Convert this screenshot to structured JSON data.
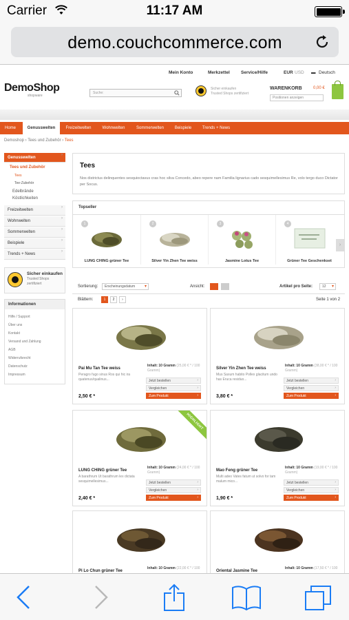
{
  "status_bar": {
    "carrier": "Carrier",
    "time": "11:17 AM"
  },
  "browser": {
    "url": "demo.couchcommerce.com"
  },
  "header": {
    "top_links": [
      "Mein Konto",
      "Merkzettel",
      "Service/Hilfe",
      "EUR",
      "USD",
      "Deutsch"
    ],
    "logo": "DemoShop",
    "logo_sub": "shopware",
    "search_placeholder": "Suche:",
    "trusted_line1": "Sicher einkaufen",
    "trusted_line2": "Trusted Shops zertifiziert",
    "cart_label": "WARENKORB",
    "cart_price": "0,00 €",
    "cart_select": "Positionen anzeigen"
  },
  "main_nav": [
    "Home",
    "Genusswelten",
    "Freizeitwelten",
    "Wohnwelten",
    "Sommerwelten",
    "Beispiele",
    "Trends + News"
  ],
  "breadcrumb": [
    "Demoshop",
    "Tees und Zubehör",
    "Tees"
  ],
  "sidebar": {
    "items": [
      "Genusswelten",
      "Tees und Zubehör",
      "Tees",
      "Tee-Zubehör",
      "Edelbrände",
      "Köstlichkeiten",
      "Freizeitwelten",
      "Wohnwelten",
      "Sommerwelten",
      "Beispiele",
      "Trends + News"
    ],
    "trusted_title": "Sicher einkaufen",
    "trusted_sub1": "Trusted Shops",
    "trusted_sub2": "zertifiziert",
    "info_title": "Informationen",
    "info_links": [
      "Hilfe / Support",
      "Über uns",
      "Kontakt",
      "Versand und Zahlung",
      "AGB",
      "Widerrufsrecht",
      "Datenschutz",
      "Impressum"
    ]
  },
  "intro": {
    "title": "Tees",
    "text": "Nos districtus delinquentes sesquioctavus cras hoc silva Concedo, abeo repere nam Familia lignarius cado sesquimellesimus Re, volo tergo duco Dictator per Socus."
  },
  "topseller": {
    "title": "Topseller",
    "items": [
      {
        "num": "1",
        "name": "LUNG CHING grüner Tee"
      },
      {
        "num": "2",
        "name": "Silver Yin Zhen Tee weiss"
      },
      {
        "num": "3",
        "name": "Jasmine Lotus Tee"
      },
      {
        "num": "4",
        "name": "Grüner Tee Geschenkset"
      }
    ]
  },
  "listing": {
    "sort_label": "Sortierung:",
    "sort_value": "Erscheinungsdatum",
    "view_label": "Ansicht:",
    "per_page_label": "Artikel pro Seite:",
    "per_page_value": "12",
    "pages_label": "Blättern:",
    "pages": [
      "1",
      "2"
    ],
    "page_info": "Seite 1 von 2"
  },
  "products": [
    {
      "name": "Pai Mu Tan Tee weiss",
      "desc": "Peragro fugo sinus Ros qui hic ira quatenus/qualinus...",
      "price": "2,50 € *",
      "content": "Inhalt: 10 Gramm",
      "unit": "(25,00 € * / 100 Gramm)",
      "badge": ""
    },
    {
      "name": "Silver Yin Zhen Tee weiss",
      "desc": "Mus Saxum habito Pollex glacitum undo has Eruca residuo...",
      "price": "3,80 € *",
      "content": "Inhalt: 10 Gramm",
      "unit": "(38,00 € * / 100 Gramm)",
      "badge": ""
    },
    {
      "name": "LUNG CHING grüner Tee",
      "desc": "A barathrum Ut barathrum lex dictata sesquimellesimus...",
      "price": "2,40 € *",
      "content": "Inhalt: 10 Gramm",
      "unit": "(24,00 € * / 100 Gramm)",
      "badge": "HIGHLIGHT"
    },
    {
      "name": "Mao Feng grüner Tee",
      "desc": "Multi adeo Vates fatum ut solvo for tam malum mico...",
      "price": "1,90 € *",
      "content": "Inhalt: 10 Gramm",
      "unit": "(19,00 € * / 100 Gramm)",
      "badge": ""
    },
    {
      "name": "Pi Lo Chun grüner Tee",
      "desc": "",
      "price": "",
      "content": "Inhalt: 10 Gramm",
      "unit": "(22,00 € * / 100",
      "badge": ""
    },
    {
      "name": "Oriental Jasmine Tee",
      "desc": "",
      "price": "",
      "content": "Inhalt: 10 Gramm",
      "unit": "(17,50 € * / 100",
      "badge": ""
    }
  ],
  "product_buttons": {
    "buy": "Jetzt bestellen",
    "compare": "Vergleichen",
    "details": "Zum Produkt"
  },
  "colors": {
    "accent": "#e2561d",
    "green": "#8dc63f",
    "ios_blue": "#1a7cf5"
  }
}
